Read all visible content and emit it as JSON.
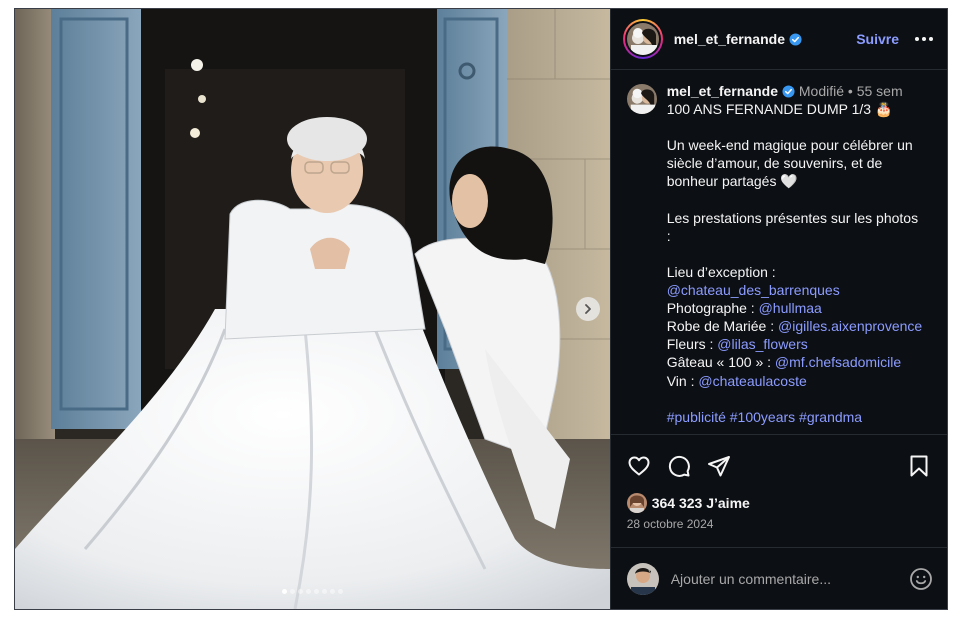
{
  "colors": {
    "background": "#0c0f14",
    "text": "#f5f5f5",
    "muted": "#a8a8a8",
    "link": "#8c9cff",
    "verified": "#3897f0"
  },
  "media": {
    "carousel_count": 8,
    "carousel_active": 1,
    "next_icon": "chevron-right-icon"
  },
  "header": {
    "username": "mel_et_fernande",
    "follow_label": "Suivre",
    "more_icon": "more-horizontal-icon"
  },
  "caption": {
    "username": "mel_et_fernande",
    "edited": "Modifié",
    "separator": "•",
    "age": "55 sem",
    "title": "100 ANS FERNANDE DUMP 1/3 🎂",
    "intro_1": "Un week-end magique pour célébrer un",
    "intro_2": "siècle d’amour, de souvenirs, et de",
    "intro_3": "bonheur partagés 🤍",
    "services_1": "Les prestations présentes sur les photos",
    "services_2": ":",
    "venue_label": "Lieu d’exception :",
    "venue_handle": "@chateau_des_barrenques",
    "photo_label": "Photographe : ",
    "photo_handle": "@hullmaa",
    "dress_label": "Robe de Mariée : ",
    "dress_handle": "@igilles.aixenprovence",
    "flowers_label": "Fleurs : ",
    "flowers_handle": "@lilas_flowers",
    "cake_label": "Gâteau « 100 » : ",
    "cake_handle": "@mf.chefsadomicile",
    "wine_label": "Vin : ",
    "wine_handle": "@chateaulacoste",
    "tags": [
      "#publicité",
      "#100years",
      "#grandma"
    ]
  },
  "actions": {
    "like_icon": "heart-icon",
    "comment_icon": "comment-bubble-icon",
    "share_icon": "paper-plane-icon",
    "save_icon": "bookmark-icon"
  },
  "likes": {
    "count_text": "364 323 J’aime"
  },
  "date": "28 octobre 2024",
  "comment": {
    "placeholder": "Ajouter un commentaire...",
    "emoji_icon": "smiley-icon"
  }
}
